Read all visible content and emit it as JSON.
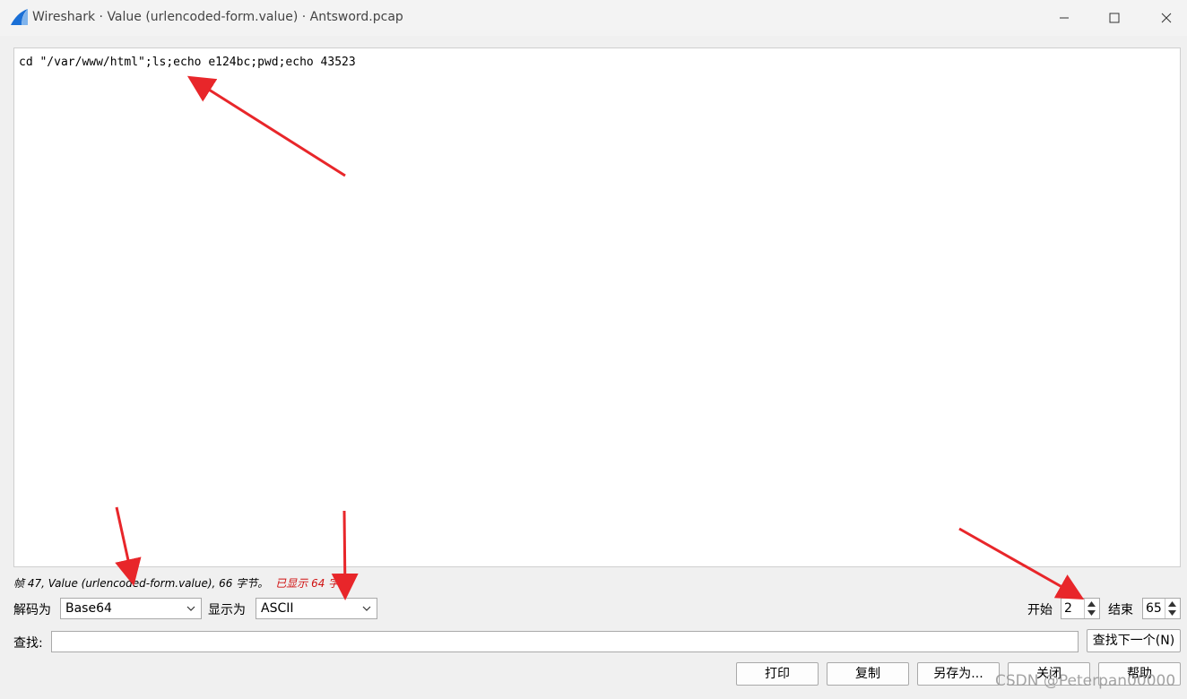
{
  "window": {
    "title": "Wireshark · Value (urlencoded-form.value) · Antsword.pcap",
    "icons": [
      "wireshark-fin-icon",
      "minimize-icon",
      "maximize-icon",
      "close-icon"
    ]
  },
  "content": {
    "text": "cd \"/var/www/html\";ls;echo e124bc;pwd;echo 43523"
  },
  "status": {
    "info": "帧 47, Value (urlencoded-form.value), 66 字节。",
    "shown": "已显示 64 字节"
  },
  "controls": {
    "decode_label": "解码为",
    "decode_value": "Base64",
    "show_label": "显示为",
    "show_value": "ASCII",
    "start_label": "开始",
    "start_value": "2",
    "end_label": "结束",
    "end_value": "65"
  },
  "find": {
    "label": "查找:",
    "value": "",
    "next_button": "查找下一个(N)"
  },
  "buttons": {
    "print": "打印",
    "copy": "复制",
    "save_as": "另存为...",
    "close": "关闭",
    "help": "帮助"
  },
  "watermark": "CSDN @Peterpan00000",
  "colors": {
    "annotation_arrow": "#e8262a",
    "status_highlight": "#d01010"
  }
}
